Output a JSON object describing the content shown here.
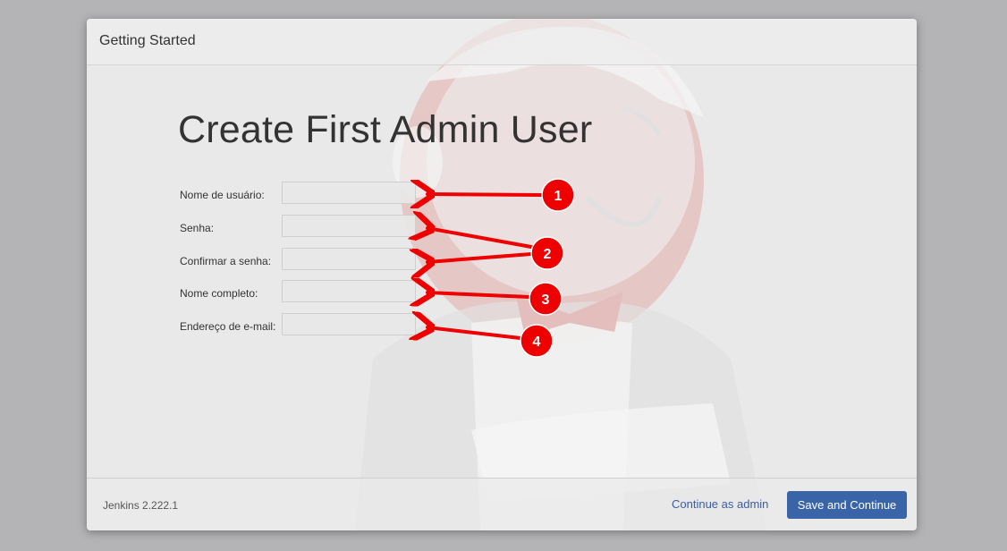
{
  "modal": {
    "title": "Getting Started",
    "heading": "Create First Admin User"
  },
  "form": {
    "fields": [
      {
        "label": "Nome de usuário:",
        "value": ""
      },
      {
        "label": "Senha:",
        "value": ""
      },
      {
        "label": "Confirmar a senha:",
        "value": ""
      },
      {
        "label": "Nome completo:",
        "value": ""
      },
      {
        "label": "Endereço de e-mail:",
        "value": ""
      }
    ]
  },
  "footer": {
    "version": "Jenkins 2.222.1",
    "continue_admin": "Continue as admin",
    "save_continue": "Save and Continue"
  },
  "annotations": {
    "badges": [
      "1",
      "2",
      "3",
      "4"
    ],
    "color": "#ee0000"
  },
  "colors": {
    "primary_button": "#3a64a8",
    "link": "#3a5ea3",
    "watermark_red": "#e8b3b1"
  },
  "icons": {
    "watermark": "jenkins-butler-logo"
  }
}
